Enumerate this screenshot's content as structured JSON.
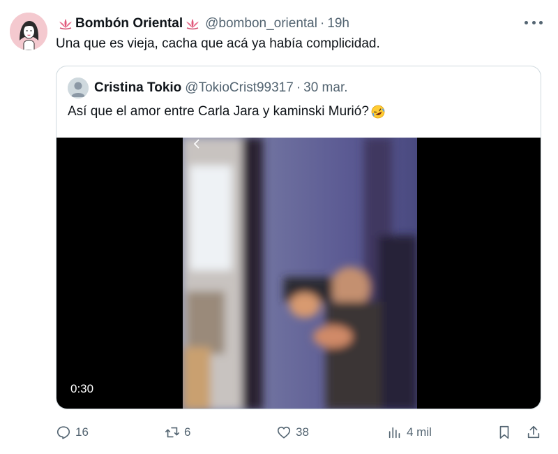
{
  "tweet": {
    "display_name": "Bombón Oriental",
    "handle": "@bombon_oriental",
    "separator": "·",
    "time": "19h",
    "text": "Una que es vieja, cacha que acá ya había complicidad.",
    "more_icon": "more-horizontal-icon",
    "name_decoration_icon": "lotus-icon"
  },
  "quoted_tweet": {
    "display_name": "Cristina Tokio",
    "handle": "@TokioCrist99317",
    "separator": "·",
    "date": "30 mar.",
    "text": "Así que el amor entre Carla Jara y kaminski Murió?",
    "emoji_icon": "rolling-on-floor-laughing-icon",
    "video": {
      "duration": "0:30"
    }
  },
  "actions": {
    "replies": "16",
    "reposts": "6",
    "likes": "38",
    "views": "4 mil"
  },
  "colors": {
    "text_primary": "#0f1419",
    "text_secondary": "#536471",
    "border": "#cfd9de",
    "video_background": "#000000"
  }
}
